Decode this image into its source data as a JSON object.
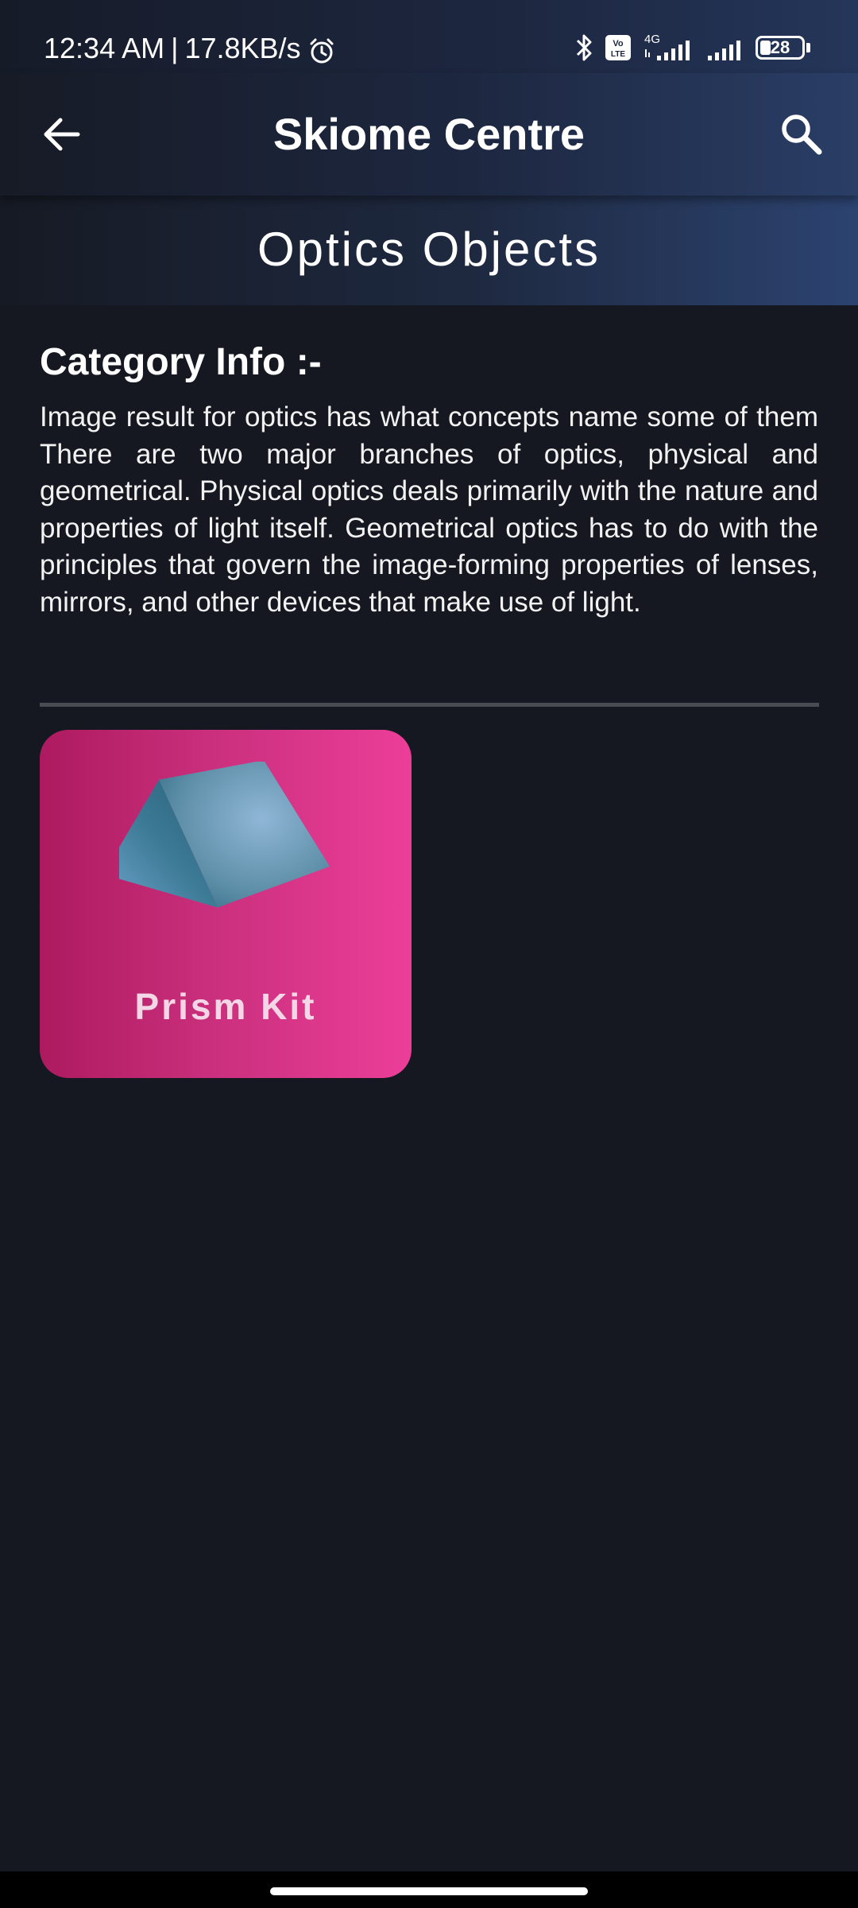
{
  "status_bar": {
    "time": "12:34 AM",
    "separator": "|",
    "speed": "17.8KB/s",
    "network": "4G",
    "volte": "Vo LTE",
    "battery": "28"
  },
  "app_bar": {
    "title": "Skiome Centre",
    "back_icon": "arrow-left-icon",
    "search_icon": "search-icon"
  },
  "category": {
    "title": "Optics Objects",
    "info_heading": "Category Info :-",
    "info_text": "Image result for optics has what concepts name some of them There are two major branches of optics, physical and geometrical. Physical optics deals primarily with the nature and properties of light itself. Geometrical optics has to do with the principles that govern the image-forming properties of lenses, mirrors, and other devices that make use of light."
  },
  "items": [
    {
      "label": "Prism Kit",
      "icon": "prism-image"
    }
  ],
  "colors": {
    "background": "#151821",
    "header_accent": "#2c4370",
    "card_start": "#ad1a5f",
    "card_end": "#ec3e99",
    "divider": "#4a4c53"
  }
}
